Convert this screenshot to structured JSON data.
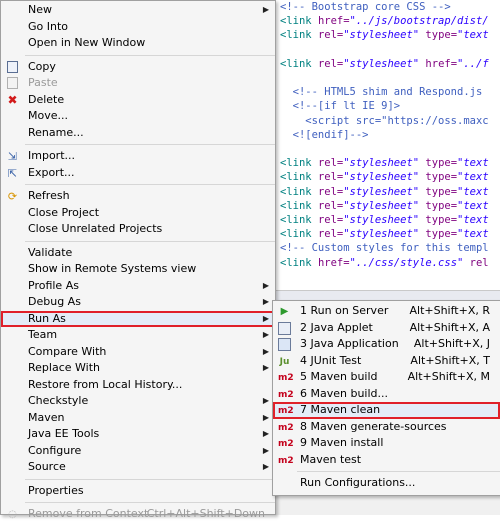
{
  "editor": {
    "lines": [
      {
        "parts": [
          {
            "t": "<!-- Bootstrap core CSS -->",
            "c": "cmt"
          }
        ]
      },
      {
        "parts": [
          {
            "t": "<link ",
            "c": "tag"
          },
          {
            "t": "href=",
            "c": "attr"
          },
          {
            "t": "\"../js/bootstrap/dist/",
            "c": "val"
          }
        ]
      },
      {
        "parts": [
          {
            "t": "<link ",
            "c": "tag"
          },
          {
            "t": "rel=",
            "c": "attr"
          },
          {
            "t": "\"stylesheet\" ",
            "c": "val"
          },
          {
            "t": "type=",
            "c": "attr"
          },
          {
            "t": "\"text",
            "c": "val"
          }
        ]
      },
      {
        "parts": []
      },
      {
        "parts": [
          {
            "t": "<link ",
            "c": "tag"
          },
          {
            "t": "rel=",
            "c": "attr"
          },
          {
            "t": "\"stylesheet\" ",
            "c": "val"
          },
          {
            "t": "href=",
            "c": "attr"
          },
          {
            "t": "\"../f",
            "c": "val"
          }
        ]
      },
      {
        "parts": []
      },
      {
        "parts": [
          {
            "t": "  <!-- HTML5 shim and Respond.js",
            "c": "cmt"
          }
        ]
      },
      {
        "parts": [
          {
            "t": "  <!--[if lt IE 9]>",
            "c": "cmt"
          }
        ]
      },
      {
        "parts": [
          {
            "t": "    <script src=\"https://oss.maxc",
            "c": "cmt"
          }
        ]
      },
      {
        "parts": [
          {
            "t": "  <![endif]-->",
            "c": "cmt"
          }
        ]
      },
      {
        "parts": []
      },
      {
        "parts": [
          {
            "t": "<link ",
            "c": "tag"
          },
          {
            "t": "rel=",
            "c": "attr"
          },
          {
            "t": "\"stylesheet\" ",
            "c": "val"
          },
          {
            "t": "type=",
            "c": "attr"
          },
          {
            "t": "\"text",
            "c": "val"
          }
        ]
      },
      {
        "parts": [
          {
            "t": "<link ",
            "c": "tag"
          },
          {
            "t": "rel=",
            "c": "attr"
          },
          {
            "t": "\"stylesheet\" ",
            "c": "val"
          },
          {
            "t": "type=",
            "c": "attr"
          },
          {
            "t": "\"text",
            "c": "val"
          }
        ]
      },
      {
        "parts": [
          {
            "t": "<link ",
            "c": "tag"
          },
          {
            "t": "rel=",
            "c": "attr"
          },
          {
            "t": "\"stylesheet\" ",
            "c": "val"
          },
          {
            "t": "type=",
            "c": "attr"
          },
          {
            "t": "\"text",
            "c": "val"
          }
        ]
      },
      {
        "parts": [
          {
            "t": "<link ",
            "c": "tag"
          },
          {
            "t": "rel=",
            "c": "attr"
          },
          {
            "t": "\"stylesheet\" ",
            "c": "val"
          },
          {
            "t": "type=",
            "c": "attr"
          },
          {
            "t": "\"text",
            "c": "val"
          }
        ]
      },
      {
        "parts": [
          {
            "t": "<link ",
            "c": "tag"
          },
          {
            "t": "rel=",
            "c": "attr"
          },
          {
            "t": "\"stylesheet\" ",
            "c": "val"
          },
          {
            "t": "type=",
            "c": "attr"
          },
          {
            "t": "\"text",
            "c": "val"
          }
        ]
      },
      {
        "parts": [
          {
            "t": "<link ",
            "c": "tag"
          },
          {
            "t": "rel=",
            "c": "attr"
          },
          {
            "t": "\"stylesheet\" ",
            "c": "val"
          },
          {
            "t": "type=",
            "c": "attr"
          },
          {
            "t": "\"text",
            "c": "val"
          }
        ]
      },
      {
        "parts": [
          {
            "t": "<!-- Custom styles for this templ",
            "c": "cmt"
          }
        ]
      },
      {
        "parts": [
          {
            "t": "<link ",
            "c": "tag"
          },
          {
            "t": "href=",
            "c": "attr"
          },
          {
            "t": "\"../css/style.css\" ",
            "c": "val"
          },
          {
            "t": "rel",
            "c": "attr"
          }
        ]
      }
    ]
  },
  "context_menu": {
    "items": [
      {
        "type": "item",
        "label": "New",
        "icon": "blank",
        "submenu": true
      },
      {
        "type": "item",
        "label": "Go Into",
        "icon": "blank"
      },
      {
        "type": "item",
        "label": "Open in New Window",
        "icon": "blank"
      },
      {
        "type": "sep"
      },
      {
        "type": "item",
        "label": "Copy",
        "icon": "copy-icon"
      },
      {
        "type": "item",
        "label": "Paste",
        "icon": "paste-icon",
        "disabled": true
      },
      {
        "type": "item",
        "label": "Delete",
        "icon": "delete-icon"
      },
      {
        "type": "item",
        "label": "Move...",
        "icon": "blank"
      },
      {
        "type": "item",
        "label": "Rename...",
        "icon": "blank"
      },
      {
        "type": "sep"
      },
      {
        "type": "item",
        "label": "Import...",
        "icon": "import-icon"
      },
      {
        "type": "item",
        "label": "Export...",
        "icon": "export-icon"
      },
      {
        "type": "sep"
      },
      {
        "type": "item",
        "label": "Refresh",
        "icon": "refresh-icon"
      },
      {
        "type": "item",
        "label": "Close Project",
        "icon": "blank"
      },
      {
        "type": "item",
        "label": "Close Unrelated Projects",
        "icon": "blank"
      },
      {
        "type": "sep"
      },
      {
        "type": "item",
        "label": "Validate",
        "icon": "blank"
      },
      {
        "type": "item",
        "label": "Show in Remote Systems view",
        "icon": "blank"
      },
      {
        "type": "item",
        "label": "Profile As",
        "icon": "blank",
        "submenu": true
      },
      {
        "type": "item",
        "label": "Debug As",
        "icon": "blank",
        "submenu": true
      },
      {
        "type": "item",
        "label": "Run As",
        "icon": "blank",
        "submenu": true,
        "highlighted": true
      },
      {
        "type": "item",
        "label": "Team",
        "icon": "blank",
        "submenu": true
      },
      {
        "type": "item",
        "label": "Compare With",
        "icon": "blank",
        "submenu": true
      },
      {
        "type": "item",
        "label": "Replace With",
        "icon": "blank",
        "submenu": true
      },
      {
        "type": "item",
        "label": "Restore from Local History...",
        "icon": "blank"
      },
      {
        "type": "item",
        "label": "Checkstyle",
        "icon": "blank",
        "submenu": true
      },
      {
        "type": "item",
        "label": "Maven",
        "icon": "blank",
        "submenu": true
      },
      {
        "type": "item",
        "label": "Java EE Tools",
        "icon": "blank",
        "submenu": true
      },
      {
        "type": "item",
        "label": "Configure",
        "icon": "blank",
        "submenu": true
      },
      {
        "type": "item",
        "label": "Source",
        "icon": "blank",
        "submenu": true
      },
      {
        "type": "sep"
      },
      {
        "type": "item",
        "label": "Properties",
        "icon": "blank"
      },
      {
        "type": "sep"
      },
      {
        "type": "item",
        "label": "Remove from Context",
        "icon": "remove-context-icon",
        "disabled": true,
        "shortcut": "Ctrl+Alt+Shift+Down"
      }
    ]
  },
  "run_as_menu": {
    "items": [
      {
        "type": "item",
        "label": "1 Run on Server",
        "icon": "server-icon",
        "shortcut": "Alt+Shift+X, R"
      },
      {
        "type": "item",
        "label": "2 Java Applet",
        "icon": "applet-icon",
        "shortcut": "Alt+Shift+X, A"
      },
      {
        "type": "item",
        "label": "3 Java Application",
        "icon": "java-app-icon",
        "shortcut": "Alt+Shift+X, J"
      },
      {
        "type": "item",
        "label": "4 JUnit Test",
        "icon": "junit-icon",
        "badge": "Ju",
        "shortcut": "Alt+Shift+X, T"
      },
      {
        "type": "item",
        "label": "5 Maven build",
        "icon": "maven-icon",
        "badge": "m2",
        "shortcut": "Alt+Shift+X, M"
      },
      {
        "type": "item",
        "label": "6 Maven build...",
        "icon": "maven-icon",
        "badge": "m2"
      },
      {
        "type": "item",
        "label": "7 Maven clean",
        "icon": "maven-icon",
        "badge": "m2",
        "highlighted": true
      },
      {
        "type": "item",
        "label": "8 Maven generate-sources",
        "icon": "maven-icon",
        "badge": "m2"
      },
      {
        "type": "item",
        "label": "9 Maven install",
        "icon": "maven-icon",
        "badge": "m2"
      },
      {
        "type": "item",
        "label": "Maven test",
        "icon": "maven-icon",
        "badge": "m2"
      },
      {
        "type": "sep"
      },
      {
        "type": "item",
        "label": "Run Configurations...",
        "icon": "blank"
      }
    ]
  },
  "colors": {
    "highlight_border": "#e0202a",
    "maven_badge": "#c4001b"
  }
}
